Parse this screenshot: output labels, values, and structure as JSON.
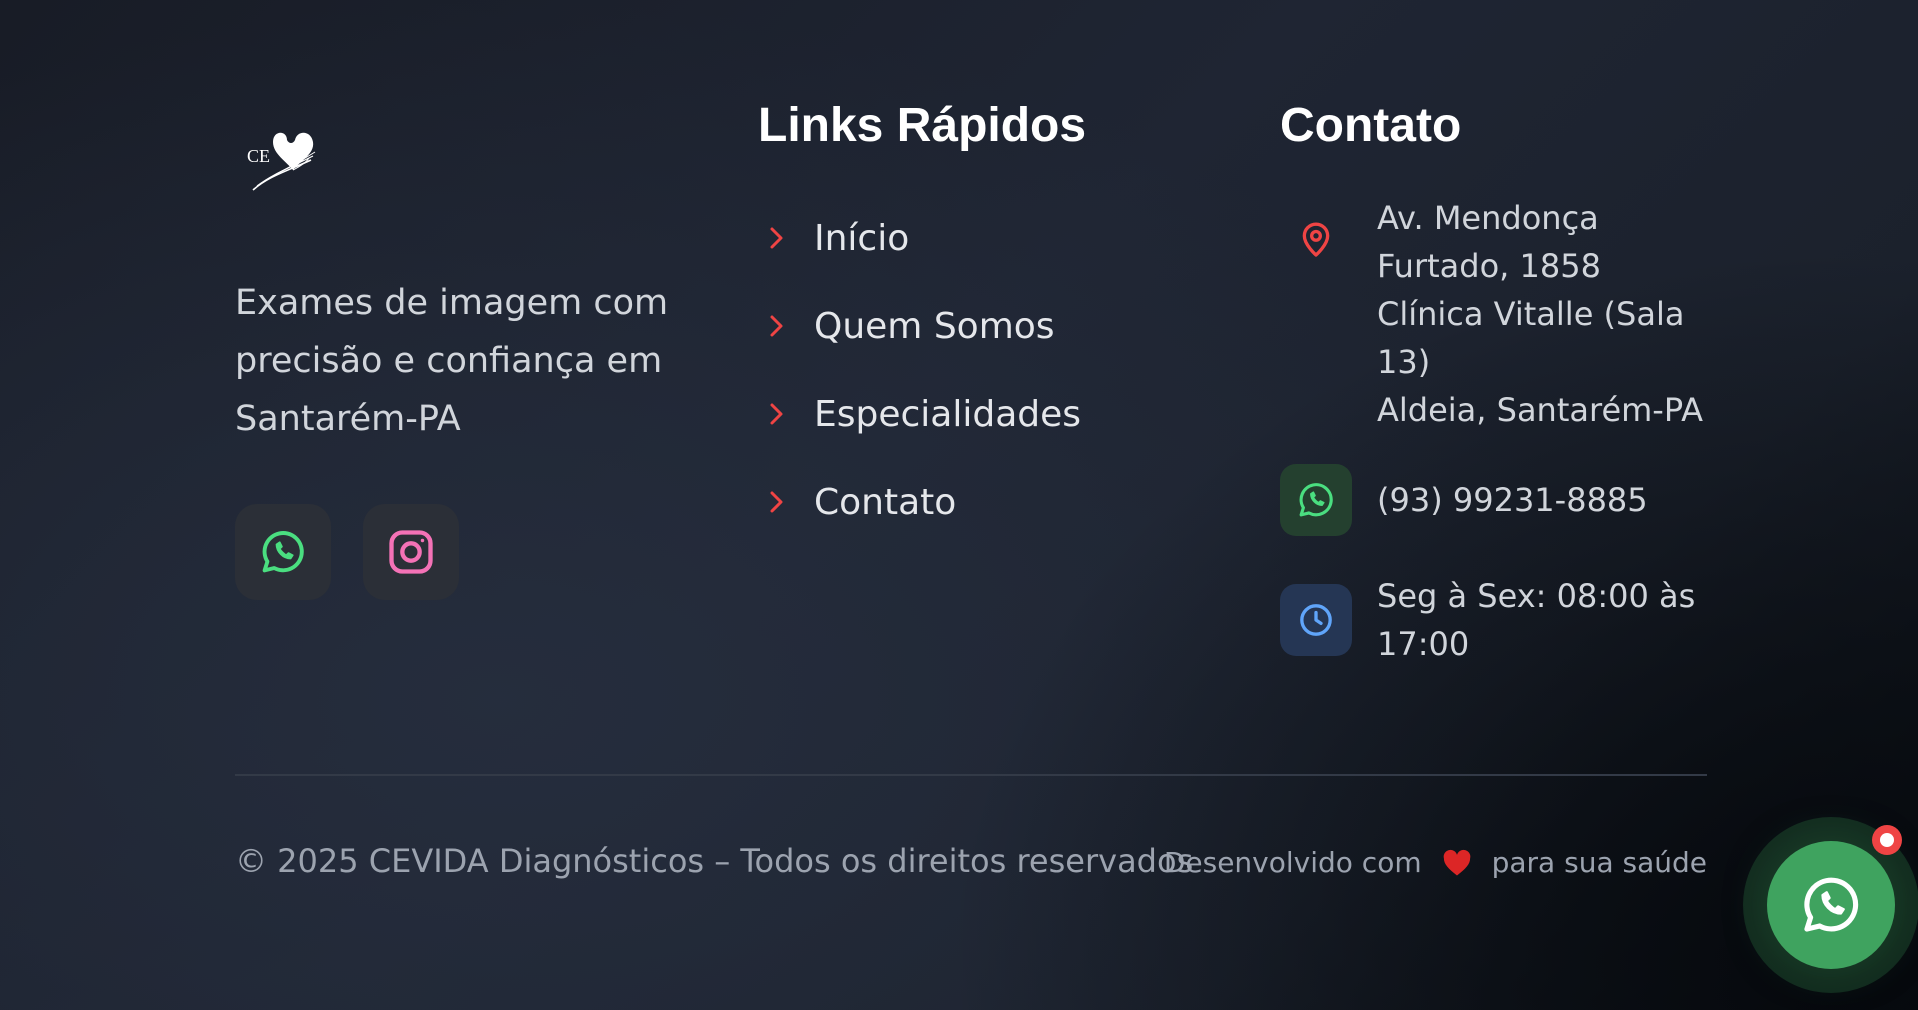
{
  "brand": {
    "logo_icon": "cevida-heart-logo",
    "logo_text": "CE",
    "tagline": "Exames de imagem com precisão e confiança em Santarém-PA",
    "socials": [
      {
        "name": "whatsapp",
        "icon": "whatsapp-icon",
        "color": "#4ade80"
      },
      {
        "name": "instagram",
        "icon": "instagram-icon",
        "color": "#f472b6"
      }
    ]
  },
  "links": {
    "title": "Links Rápidos",
    "items": [
      {
        "label": "Início"
      },
      {
        "label": "Quem Somos"
      },
      {
        "label": "Especialidades"
      },
      {
        "label": "Contato"
      }
    ],
    "chevron_color": "#ef4444"
  },
  "contact": {
    "title": "Contato",
    "address_lines": [
      "Av. Mendonça",
      "Furtado, 1858",
      "Clínica Vitalle (Sala",
      "13)",
      "Aldeia, Santarém-PA"
    ],
    "phone": "(93) 99231-8885",
    "hours_lines": [
      "Seg à Sex: 08:00 às",
      "17:00"
    ],
    "colors": {
      "pin": "#ef4444",
      "whatsapp": "#4ade80",
      "clock": "#60a5fa"
    }
  },
  "bottom": {
    "copyright": "© 2025 CEVIDA Diagnósticos – Todos os direitos reservados",
    "credit_before": "Desenvolvido com",
    "credit_after": "para sua saúde",
    "heart_color": "#dc2626"
  },
  "floating_whatsapp": {
    "icon": "whatsapp-icon",
    "badge_color": "#ef4444",
    "button_color": "#3fa35f"
  }
}
